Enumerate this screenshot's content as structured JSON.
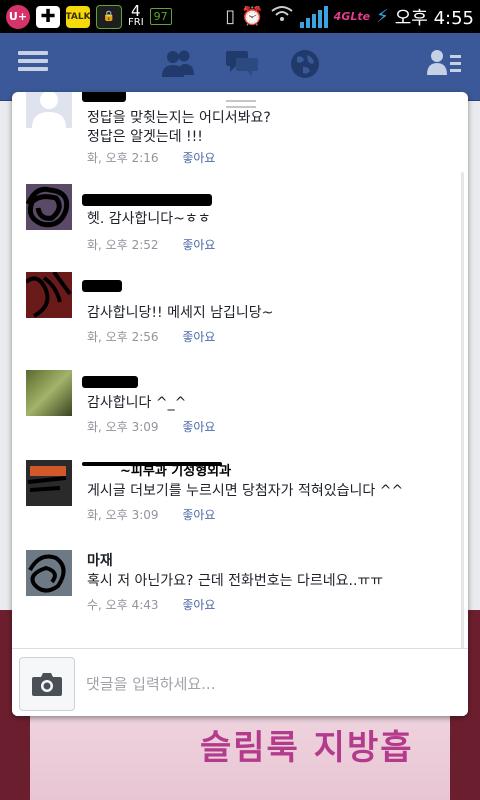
{
  "status_bar": {
    "carrier_icon": "U+",
    "calendar_day": "4",
    "calendar_weekday": "FRI",
    "battery_small": "97",
    "lte_label": "4GLte",
    "time": "오후 4:55",
    "icons": [
      "u-plus-icon",
      "plus-icon",
      "kakaotalk-icon",
      "lock-icon",
      "calendar-icon",
      "battery-icon",
      "vibrate-icon",
      "alarm-icon",
      "wifi-icon",
      "signal-icon",
      "lte-icon",
      "charging-icon"
    ]
  },
  "header": {
    "icons": [
      "menu-icon",
      "friends-icon",
      "messages-icon",
      "notifications-globe-icon",
      "friend-list-icon"
    ]
  },
  "comments": [
    {
      "text_lines": [
        "정답을 맞췻는지는 어디서봐요?",
        "정답은 알겟는데 !!!"
      ],
      "time": "화, 오후 2:16",
      "like": "좋아요"
    },
    {
      "text_lines": [
        "헷. 감사합니다~ㅎㅎ"
      ],
      "time": "화, 오후 2:52",
      "like": "좋아요"
    },
    {
      "text_lines": [
        "감사합니당!! 메세지 남깁니당~"
      ],
      "time": "화, 오후 2:56",
      "like": "좋아요"
    },
    {
      "text_lines": [
        "감사합니다 ^_^"
      ],
      "time": "화, 오후 3:09",
      "like": "좋아요"
    },
    {
      "author_visible": "~피부과 기성형외과",
      "text_lines": [
        "게시글 더보기를 누르시면 당첨자가 적혀있습니다 ^^"
      ],
      "time": "화, 오후 3:09",
      "like": "좋아요"
    },
    {
      "author_visible": "마재",
      "text_lines": [
        "혹시 저 아닌가요? 근데 전화번호는 다르네요..ㅠㅠ"
      ],
      "time": "수, 오후 4:43",
      "like": "좋아요"
    }
  ],
  "composer": {
    "placeholder": "댓글을 입력하세요..."
  },
  "background": {
    "ad_text": "슬림룩 지방흡"
  },
  "colors": {
    "facebook_blue": "#3b5998",
    "link": "#4b6aa8",
    "meta": "#90949c"
  }
}
